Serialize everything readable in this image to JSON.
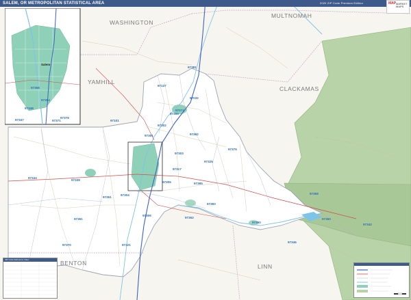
{
  "title": "SALEM, OR METROPOLITAN STATISTICAL AREA",
  "edition": "2020 ZIP Code Premium Edition",
  "brand": {
    "mark": "MAP",
    "line1": "MARKET",
    "line2": "MAPS"
  },
  "counties": [
    {
      "name": "WASHINGTON"
    },
    {
      "name": "MULTNOMAH"
    },
    {
      "name": "YAMHILL"
    },
    {
      "name": "CLACKAMAS"
    },
    {
      "name": "LINN"
    },
    {
      "name": "BENTON"
    }
  ],
  "zip_codes": [
    "97137",
    "97032",
    "97071",
    "97381",
    "97362",
    "97375",
    "97101",
    "97378",
    "97325",
    "97385",
    "97317",
    "97305",
    "97304",
    "97301",
    "97302",
    "97306",
    "97303",
    "97338",
    "97344",
    "97347",
    "97371",
    "97361",
    "97351",
    "97352",
    "97383",
    "97360",
    "97350",
    "97358",
    "97346",
    "97370",
    "97321",
    "97342",
    "97355",
    "97348",
    "97368",
    "97384"
  ],
  "inset": {
    "city": "Salem"
  },
  "zip_table": {
    "header": "ZIP Code Reference Index"
  },
  "colors": {
    "title_bar": "#3d5a8a",
    "background": "#f7f5ef",
    "msa_fill": "#ffffff",
    "forest": "#b9d3a9",
    "urban": "#8fd1b8",
    "water": "#7ec3e8",
    "zip_label": "#2b6fb5",
    "highway": "#3b62c7"
  }
}
